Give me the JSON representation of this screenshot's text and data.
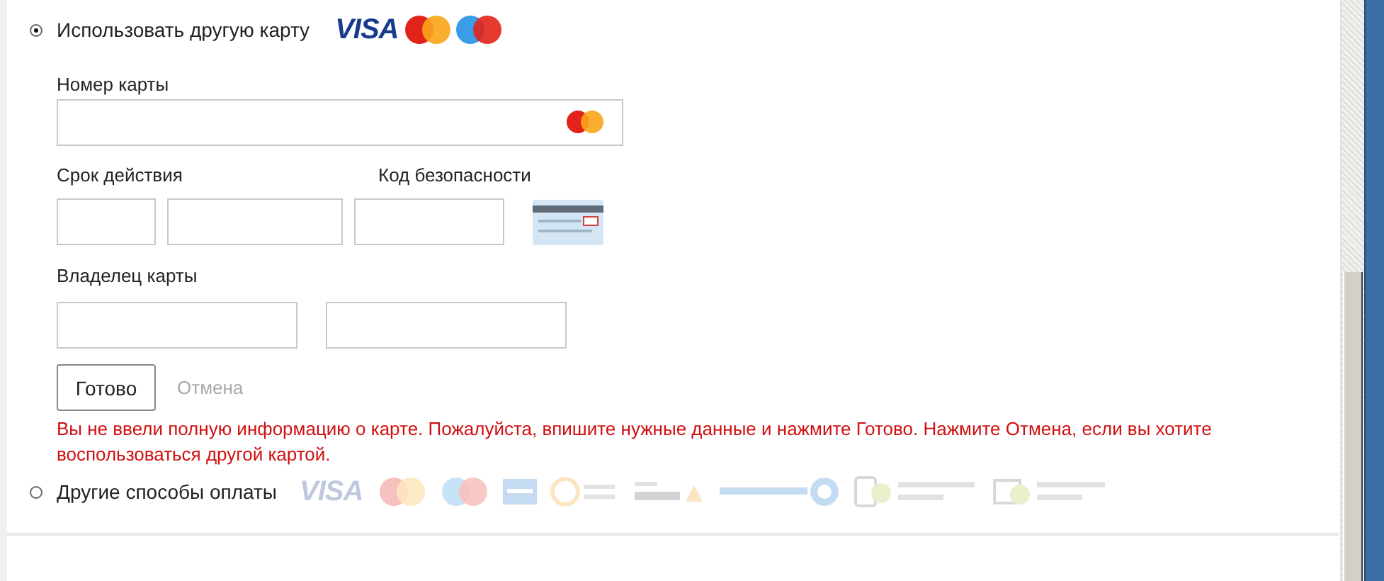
{
  "card_option": {
    "label": "Использовать другую карту",
    "selected": true,
    "logos": [
      {
        "kind": "visa",
        "label": "VISA"
      },
      {
        "kind": "mastercard"
      },
      {
        "kind": "maestro"
      }
    ]
  },
  "form": {
    "card_number_label": "Номер карты",
    "expiry_label": "Срок действия",
    "cvv_label": "Код безопасности",
    "owner_label": "Владелец карты"
  },
  "buttons": {
    "done": "Готово",
    "cancel": "Отмена"
  },
  "error": "Вы не ввели полную информацию о карте. Пожалуйста, впишите нужные данные и нажмите Готово. Нажмите Отмена, если вы хотите воспользоваться другой картой.",
  "other_option": {
    "label": "Другие способы оплаты",
    "selected": false,
    "logos": [
      {
        "kind": "visa",
        "label": "VISA"
      },
      {
        "kind": "mastercard"
      },
      {
        "kind": "maestro"
      },
      {
        "kind": "amex"
      },
      {
        "kind": "qiwi"
      },
      {
        "kind": "yandex"
      },
      {
        "kind": "webmoney"
      },
      {
        "kind": "mobile"
      },
      {
        "kind": "cash"
      }
    ]
  }
}
